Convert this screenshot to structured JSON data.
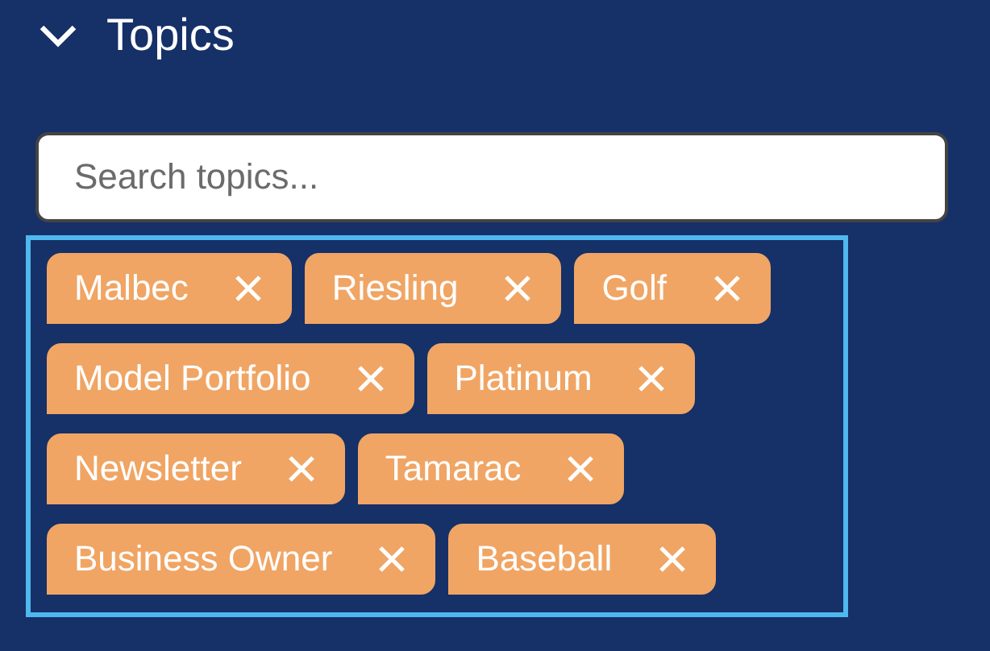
{
  "section": {
    "title": "Topics",
    "expanded": true
  },
  "search": {
    "placeholder": "Search topics..."
  },
  "tags": [
    {
      "label": "Malbec"
    },
    {
      "label": "Riesling"
    },
    {
      "label": "Golf"
    },
    {
      "label": "Model Portfolio"
    },
    {
      "label": "Platinum"
    },
    {
      "label": "Newsletter"
    },
    {
      "label": "Tamarac"
    },
    {
      "label": "Business Owner"
    },
    {
      "label": "Baseball"
    }
  ]
}
